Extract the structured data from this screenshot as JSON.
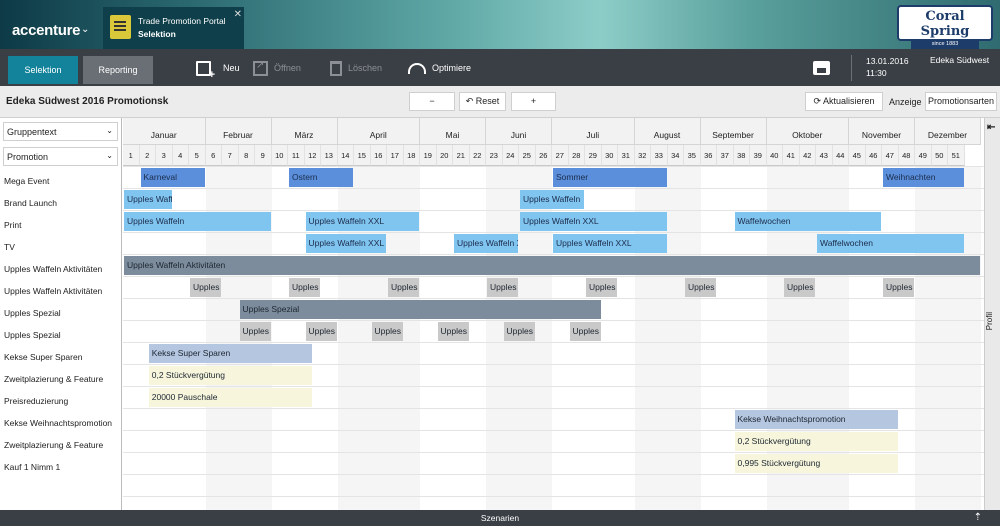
{
  "header": {
    "brand": "accenture",
    "app_title": "Trade Promotion Portal",
    "app_subtitle": "Selektion",
    "logo_name": "Coral Spring",
    "logo_tagline": "since 1883"
  },
  "nav": {
    "tabs": [
      "Selektion",
      "Reporting"
    ],
    "tools": {
      "new": "Neu",
      "open": "Öffnen",
      "delete": "Löschen",
      "optimize": "Optimiere"
    },
    "date": "13.01.2016",
    "time": "11:30",
    "store": "Edeka Südwest"
  },
  "toolbar": {
    "title": "Edeka Südwest 2016 Promotionsk",
    "minus": "−",
    "reset": "↶ Reset",
    "plus": "+",
    "refresh": "⟳ Aktualisieren",
    "display_label": "Anzeige",
    "display_value": "Promotionsarten"
  },
  "filters": {
    "group": "Gruppentext",
    "promotion": "Promotion"
  },
  "row_labels": [
    "Mega Event",
    "Brand Launch",
    "Print",
    "TV",
    "Upples Waffeln Aktivitäten",
    "Upples Waffeln Aktivitäten",
    "Upples Spezial",
    "Upples Spezial",
    "Kekse Super Sparen",
    "Zweitplazierung & Feature",
    "Preisreduzierung",
    "Kekse Weihnachtspromotion",
    "Zweitplazierung & Feature",
    "Kauf 1 Nimm 1"
  ],
  "months": [
    "Januar",
    "Februar",
    "März",
    "April",
    "Mai",
    "Juni",
    "Juli",
    "August",
    "September",
    "Oktober",
    "November",
    "Dezember"
  ],
  "weeks": [
    "1",
    "2",
    "3",
    "4",
    "5",
    "6",
    "7",
    "8",
    "9",
    "10",
    "11",
    "12",
    "13",
    "14",
    "15",
    "16",
    "17",
    "18",
    "19",
    "20",
    "21",
    "22",
    "23",
    "24",
    "25",
    "26",
    "27",
    "28",
    "29",
    "30",
    "31",
    "32",
    "33",
    "34",
    "35",
    "36",
    "37",
    "38",
    "39",
    "40",
    "41",
    "42",
    "43",
    "44",
    "45",
    "46",
    "47",
    "48",
    "49",
    "50",
    "51"
  ],
  "bars": [
    {
      "label": "Karneval",
      "row": 0,
      "s": 1,
      "e": 5,
      "c": "dark"
    },
    {
      "label": "Ostern",
      "row": 0,
      "s": 10,
      "e": 14,
      "c": "dark"
    },
    {
      "label": "Sommer",
      "row": 0,
      "s": 26,
      "e": 33,
      "c": "dark"
    },
    {
      "label": "Weihnachten",
      "row": 0,
      "s": 46,
      "e": 51,
      "c": "dark"
    },
    {
      "label": "Upples Waffeln",
      "row": 1,
      "s": 0,
      "e": 3,
      "c": "light"
    },
    {
      "label": "Upples Waffeln",
      "row": 1,
      "s": 24,
      "e": 28,
      "c": "light"
    },
    {
      "label": "Upples Waffeln",
      "row": 2,
      "s": 0,
      "e": 9,
      "c": "light"
    },
    {
      "label": "Upples Waffeln XXL",
      "row": 2,
      "s": 11,
      "e": 18,
      "c": "light"
    },
    {
      "label": "Upples Waffeln XXL",
      "row": 2,
      "s": 24,
      "e": 33,
      "c": "light"
    },
    {
      "label": "Waffelwochen",
      "row": 2,
      "s": 37,
      "e": 46,
      "c": "light"
    },
    {
      "label": "Upples Waffeln XXL",
      "row": 3,
      "s": 11,
      "e": 16,
      "c": "light"
    },
    {
      "label": "Upples Waffeln XXL",
      "row": 3,
      "s": 20,
      "e": 24,
      "c": "light"
    },
    {
      "label": "Upples Waffeln XXL",
      "row": 3,
      "s": 26,
      "e": 33,
      "c": "light"
    },
    {
      "label": "Waffelwochen",
      "row": 3,
      "s": 42,
      "e": 51,
      "c": "light"
    },
    {
      "label": "Upples Waffeln Aktivitäten",
      "row": 4,
      "s": 0,
      "e": 52,
      "c": "gray"
    },
    {
      "label": "Upples Waffeln",
      "row": 5,
      "s": 4,
      "e": 6,
      "c": "silver"
    },
    {
      "label": "Upples Waffeln",
      "row": 5,
      "s": 10,
      "e": 12,
      "c": "silver"
    },
    {
      "label": "Upples Waffeln",
      "row": 5,
      "s": 16,
      "e": 18,
      "c": "silver"
    },
    {
      "label": "Upples Waffeln",
      "row": 5,
      "s": 22,
      "e": 24,
      "c": "silver"
    },
    {
      "label": "Upples Waffeln",
      "row": 5,
      "s": 28,
      "e": 30,
      "c": "silver"
    },
    {
      "label": "Upples Waffeln",
      "row": 5,
      "s": 34,
      "e": 36,
      "c": "silver"
    },
    {
      "label": "Upples Waffeln",
      "row": 5,
      "s": 40,
      "e": 42,
      "c": "silver"
    },
    {
      "label": "Upples Waffeln",
      "row": 5,
      "s": 46,
      "e": 48,
      "c": "silver"
    },
    {
      "label": "Upples Spezial",
      "row": 6,
      "s": 7,
      "e": 29,
      "c": "gray"
    },
    {
      "label": "Upples Spezial",
      "row": 7,
      "s": 7,
      "e": 9,
      "c": "silver"
    },
    {
      "label": "Upples Spezial",
      "row": 7,
      "s": 11,
      "e": 13,
      "c": "silver"
    },
    {
      "label": "Upples Spezial",
      "row": 7,
      "s": 15,
      "e": 17,
      "c": "silver"
    },
    {
      "label": "Upples Spezial",
      "row": 7,
      "s": 19,
      "e": 21,
      "c": "silver"
    },
    {
      "label": "Upples Spezial",
      "row": 7,
      "s": 23,
      "e": 25,
      "c": "silver"
    },
    {
      "label": "Upples Spezial",
      "row": 7,
      "s": 27,
      "e": 29,
      "c": "silver"
    },
    {
      "label": "Kekse Super Sparen",
      "row": 8,
      "s": 1.5,
      "e": 11.5,
      "c": "pale"
    },
    {
      "label": "0,2 Stückvergütung",
      "row": 9,
      "s": 1.5,
      "e": 11.5,
      "c": "cream"
    },
    {
      "label": "20000 Pauschale",
      "row": 10,
      "s": 1.5,
      "e": 11.5,
      "c": "cream"
    },
    {
      "label": "Kekse Weihnachtspromotion",
      "row": 11,
      "s": 37,
      "e": 47,
      "c": "pale"
    },
    {
      "label": "0,2 Stückvergütung",
      "row": 12,
      "s": 37,
      "e": 47,
      "c": "cream"
    },
    {
      "label": "0,995 Stückvergütung",
      "row": 13,
      "s": 37,
      "e": 47,
      "c": "cream"
    }
  ],
  "sidebar": {
    "label": "Profil"
  },
  "bottom": {
    "label": "Szenarien"
  }
}
